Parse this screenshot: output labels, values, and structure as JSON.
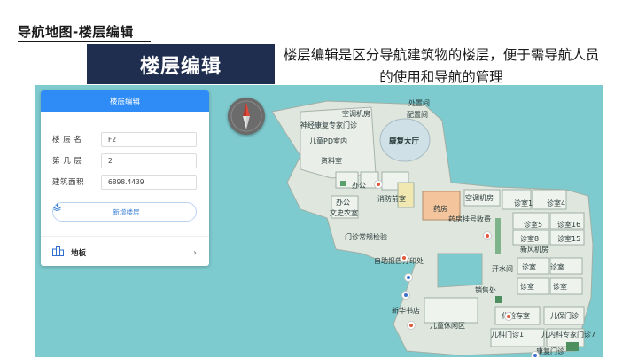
{
  "header": {
    "title": "导航地图-楼层编辑",
    "section": "楼层编辑",
    "description": "楼层编辑是区分导航建筑物的楼层，便于需导航人员的使用和导航的管理"
  },
  "panel": {
    "title": "楼层编辑",
    "fields": [
      {
        "label": "楼 层 名",
        "value": "F2"
      },
      {
        "label": "第 几 层",
        "value": "2"
      },
      {
        "label": "建筑面积",
        "value": "6898.4439"
      }
    ],
    "add_button": "新增楼层",
    "floor_item": "地板",
    "icons": {
      "add": "plus-stack-icon",
      "floor": "building-icon",
      "chevron": "chevron-right-icon"
    }
  },
  "map": {
    "colors": {
      "water": "#7ecbcf",
      "ground": "#dfe6de",
      "room": "#eef3ee",
      "pharmacy": "#f4c59d",
      "accent": "#2f8cf6"
    },
    "labels": [
      "处置间",
      "空调机房",
      "配置间",
      "神经康复专家门诊",
      "康复大厅",
      "儿童PD室内",
      "资料室",
      "办公",
      "消防前室",
      "办公",
      "文史农室",
      "药房",
      "空调机房",
      "诊室1",
      "诊室4",
      "药房挂号收费",
      "诊室5",
      "诊室16",
      "门诊常规检验",
      "诊室8",
      "诊室15",
      "新风机房",
      "自助报告打印处",
      "开水间",
      "诊室",
      "诊室",
      "销售处",
      "诊室",
      "诊室",
      "新华书店",
      "化验存室",
      "儿保门诊",
      "儿童休闲区",
      "儿科门诊1",
      "儿内科专家门诊7",
      "康复门诊"
    ]
  }
}
